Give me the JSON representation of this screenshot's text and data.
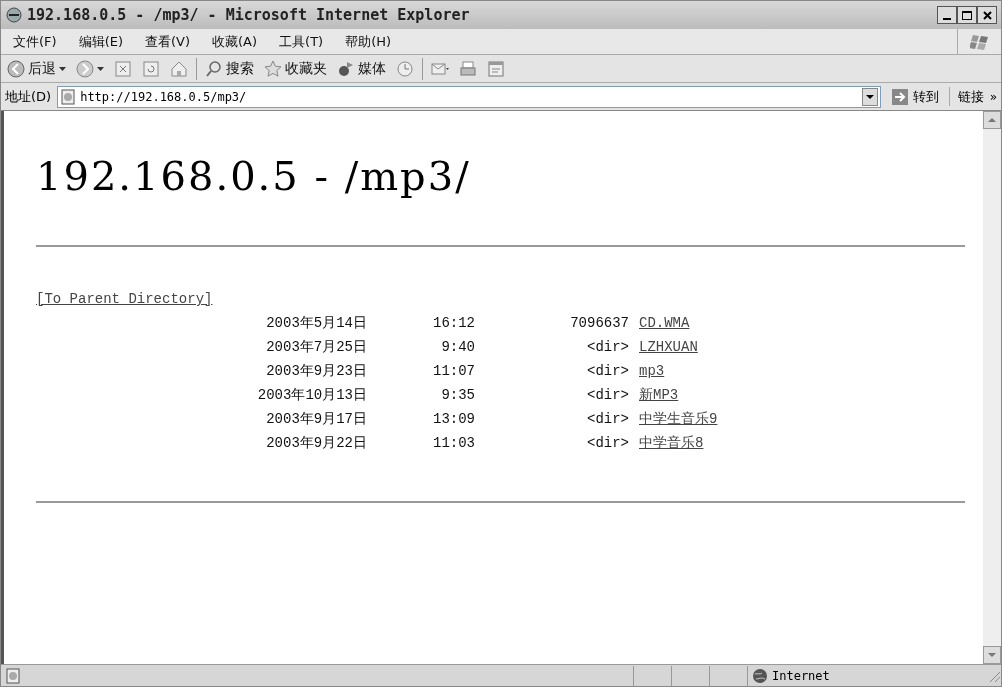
{
  "window": {
    "title": "192.168.0.5 - /mp3/ - Microsoft Internet Explorer"
  },
  "menu": [
    "文件(F)",
    "编辑(E)",
    "查看(V)",
    "收藏(A)",
    "工具(T)",
    "帮助(H)"
  ],
  "toolbar": [
    {
      "kind": "back",
      "label": "后退"
    },
    {
      "kind": "forward"
    },
    {
      "kind": "stop"
    },
    {
      "kind": "refresh"
    },
    {
      "kind": "home"
    },
    {
      "kind": "search",
      "label": "搜索"
    },
    {
      "kind": "favorites",
      "label": "收藏夹"
    },
    {
      "kind": "media",
      "label": "媒体"
    },
    {
      "kind": "history"
    },
    {
      "kind": "mail"
    },
    {
      "kind": "print"
    },
    {
      "kind": "edit"
    }
  ],
  "address": {
    "label": "地址(D)",
    "value": "http://192.168.0.5/mp3/",
    "go": "转到",
    "links": "链接",
    "more": "»"
  },
  "page": {
    "heading": "192.168.0.5 - /mp3/",
    "parent_link": "[To Parent Directory]",
    "entries": [
      {
        "date": "2003年5月14日",
        "time": "16:12",
        "size": "7096637",
        "name": "CD.WMA"
      },
      {
        "date": "2003年7月25日",
        "time": "9:40",
        "size": "<dir>",
        "name": "LZHXUAN"
      },
      {
        "date": "2003年9月23日",
        "time": "11:07",
        "size": "<dir>",
        "name": "mp3"
      },
      {
        "date": "2003年10月13日",
        "time": "9:35",
        "size": "<dir>",
        "name": "新MP3"
      },
      {
        "date": "2003年9月17日",
        "time": "13:09",
        "size": "<dir>",
        "name": "中学生音乐9"
      },
      {
        "date": "2003年9月22日",
        "time": "11:03",
        "size": "<dir>",
        "name": "中学音乐8"
      }
    ]
  },
  "status_bar": {
    "zone": "Internet"
  }
}
